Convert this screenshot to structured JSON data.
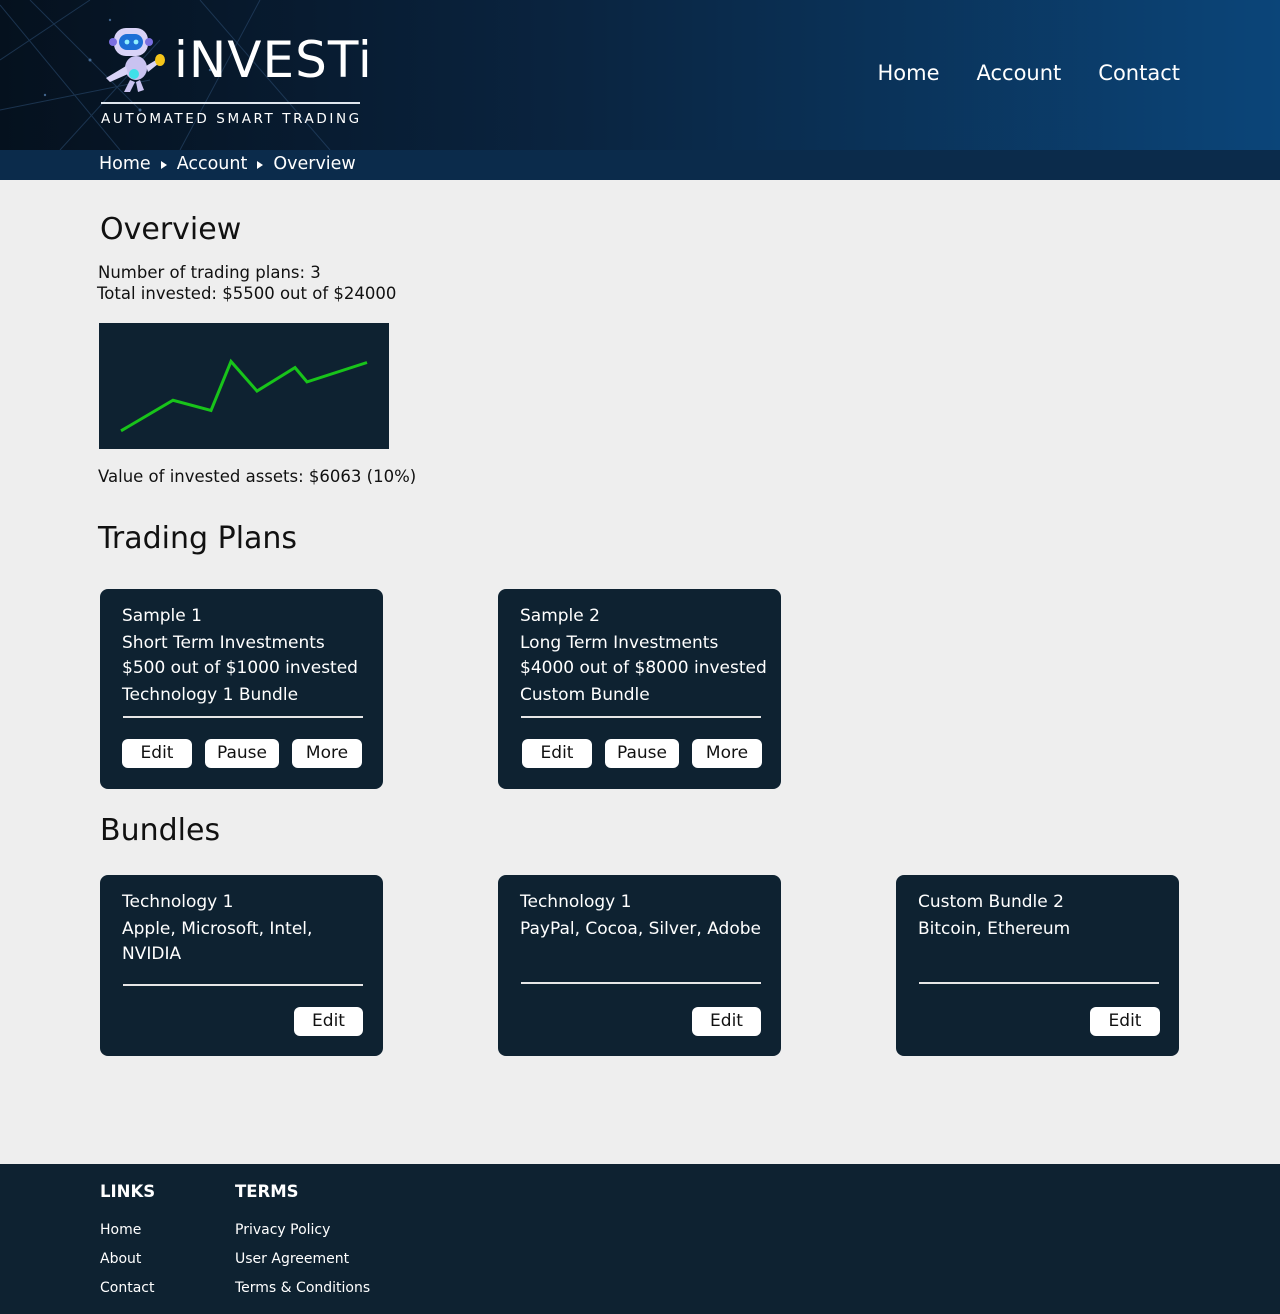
{
  "brand": {
    "name": "iNVESTi",
    "tagline": "AUTOMATED SMART TRADING"
  },
  "nav": {
    "items": [
      "Home",
      "Account",
      "Contact"
    ]
  },
  "breadcrumb": [
    "Home",
    "Account",
    "Overview"
  ],
  "overview": {
    "title": "Overview",
    "plans_count": "Number of trading plans: 3",
    "total_invested": "Total invested: $5500 out of $24000",
    "assets_value": "Value of invested assets: $6063 (10%)"
  },
  "chart_data": {
    "type": "line",
    "title": "",
    "xlabel": "",
    "ylabel": "",
    "grid": false,
    "legend": "none",
    "colors": {
      "background": "#0e2231",
      "line": "#18c41a"
    },
    "x": [
      1,
      2,
      3,
      4,
      5,
      6,
      7,
      8,
      9
    ],
    "ylim": [
      0,
      100
    ],
    "series": [
      {
        "values": [
          8,
          38,
          28,
          76,
          47,
          70,
          56,
          75
        ]
      }
    ]
  },
  "trading_plans": {
    "title": "Trading Plans",
    "cards": [
      {
        "name": "Sample 1",
        "term": "Short Term Investments",
        "invested": "$500 out of $1000 invested",
        "bundle": "Technology 1 Bundle",
        "buttons": {
          "edit": "Edit",
          "pause": "Pause",
          "more": "More"
        }
      },
      {
        "name": "Sample 2",
        "term": "Long Term Investments",
        "invested": "$4000 out of $8000 invested",
        "bundle": "Custom Bundle",
        "buttons": {
          "edit": "Edit",
          "pause": "Pause",
          "more": "More"
        }
      }
    ]
  },
  "bundles": {
    "title": "Bundles",
    "cards": [
      {
        "name": "Technology 1",
        "assets_line1": "Apple, Microsoft, Intel,",
        "assets_line2": "NVIDIA",
        "edit": "Edit"
      },
      {
        "name": "Technology 1",
        "assets_line1": "PayPal, Cocoa, Silver, Adobe",
        "assets_line2": "",
        "edit": "Edit"
      },
      {
        "name": "Custom Bundle 2",
        "assets_line1": "Bitcoin, Ethereum",
        "assets_line2": "",
        "edit": "Edit"
      }
    ]
  },
  "footer": {
    "links_heading": "LINKS",
    "links": [
      "Home",
      "About",
      "Contact"
    ],
    "terms_heading": "TERMS",
    "terms": [
      "Privacy Policy",
      "User Agreement",
      "Terms & Conditions"
    ]
  },
  "colors": {
    "header_dark": "#05111e",
    "header_light": "#0b4579",
    "breadcrumb_bar": "#0b2b4b",
    "card": "#0e2231",
    "page_bg": "#eeeeee",
    "chart_line": "#18c41a"
  }
}
